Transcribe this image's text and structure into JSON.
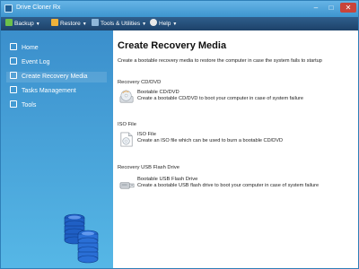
{
  "window": {
    "title": "Drive Cloner Rx",
    "controls": {
      "minimize": "–",
      "maximize": "□",
      "close": "✕"
    }
  },
  "toolbar": {
    "items": [
      {
        "label": "Backup",
        "icon": "backup-icon",
        "color": "#6cc04a"
      },
      {
        "label": "Restore",
        "icon": "restore-icon",
        "color": "#f0b23a"
      },
      {
        "label": "Tools & Utilities",
        "icon": "tools-icon",
        "color": "#8fb7d9"
      },
      {
        "label": "Help",
        "icon": "help-icon",
        "color": "#e9e9e9"
      }
    ]
  },
  "sidebar": {
    "items": [
      {
        "label": "Home",
        "icon": "home-icon"
      },
      {
        "label": "Event Log",
        "icon": "event-log-icon"
      },
      {
        "label": "Create Recovery Media",
        "icon": "recovery-media-icon",
        "active": true
      },
      {
        "label": "Tasks Management",
        "icon": "tasks-icon"
      },
      {
        "label": "Tools",
        "icon": "tools-icon"
      }
    ]
  },
  "main": {
    "title": "Create Recovery Media",
    "description": "Create a bootable recovery media to restore the computer in case the system fails to startup",
    "sections": [
      {
        "heading": "Recovery CD/DVD",
        "option": {
          "title": "Bootable CD/DVD",
          "description": "Create a bootable CD/DVD to boot your computer in case of system failure",
          "icon": "cd-dvd-icon"
        }
      },
      {
        "heading": "ISO File",
        "option": {
          "title": "ISO File",
          "description": "Create an ISO file which can be used to burn a bootable CD/DVD",
          "icon": "iso-file-icon"
        }
      },
      {
        "heading": "Recovery USB Flash Drive",
        "option": {
          "title": "Bootable USB Flash Drive",
          "description": "Create a bootable USB flash drive to boot your computer in case of system failure",
          "icon": "usb-drive-icon"
        }
      }
    ]
  },
  "colors": {
    "titlebar": "#4ba3dc",
    "toolbar": "#24507d",
    "sidebar": "#48a6dc",
    "close_button": "#c9443a"
  }
}
